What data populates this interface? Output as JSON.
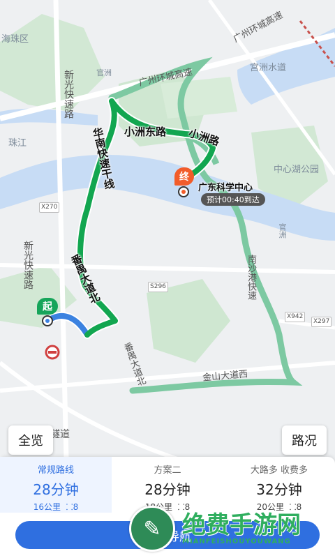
{
  "map": {
    "districts": [
      "海珠区",
      "中心湖公园",
      "宫洲水道",
      "珠江"
    ],
    "roads": [
      "新光快速路",
      "广州环城高速",
      "广州环城高速",
      "华南快速干线",
      "小洲东路",
      "小洲路",
      "番禺大道北",
      "番禺大道北",
      "南沙港快速",
      "金山大道西",
      "新光快速路",
      "隧道",
      "官洲",
      "官洲"
    ],
    "shields": [
      "X270",
      "S296",
      "X942",
      "X297"
    ]
  },
  "markers": {
    "start": "起",
    "end": "终",
    "destination": "广东科学中心",
    "eta": "预计00:40到达"
  },
  "buttons": {
    "overview": "全览",
    "traffic": "路况",
    "navigate": "开始导航"
  },
  "plans": [
    {
      "name": "常规路线",
      "time": "28分钟",
      "distance": "16公里",
      "lights": "8",
      "selected": true
    },
    {
      "name": "方案二",
      "time": "28分钟",
      "distance": "18公里",
      "lights": "8",
      "selected": false
    },
    {
      "name": "大路多  收费多",
      "time": "32分钟",
      "distance": "20公里",
      "lights": "8",
      "selected": false
    }
  ],
  "watermark": {
    "title": "绝费手游网",
    "sub": "MIANFEISHOUYOUWANG"
  },
  "colors": {
    "route": "#12a650",
    "alt_route": "#7dc9a2",
    "accent": "#2f6fe0",
    "end_marker": "#f25c2a",
    "river": "#c7dcf5"
  }
}
